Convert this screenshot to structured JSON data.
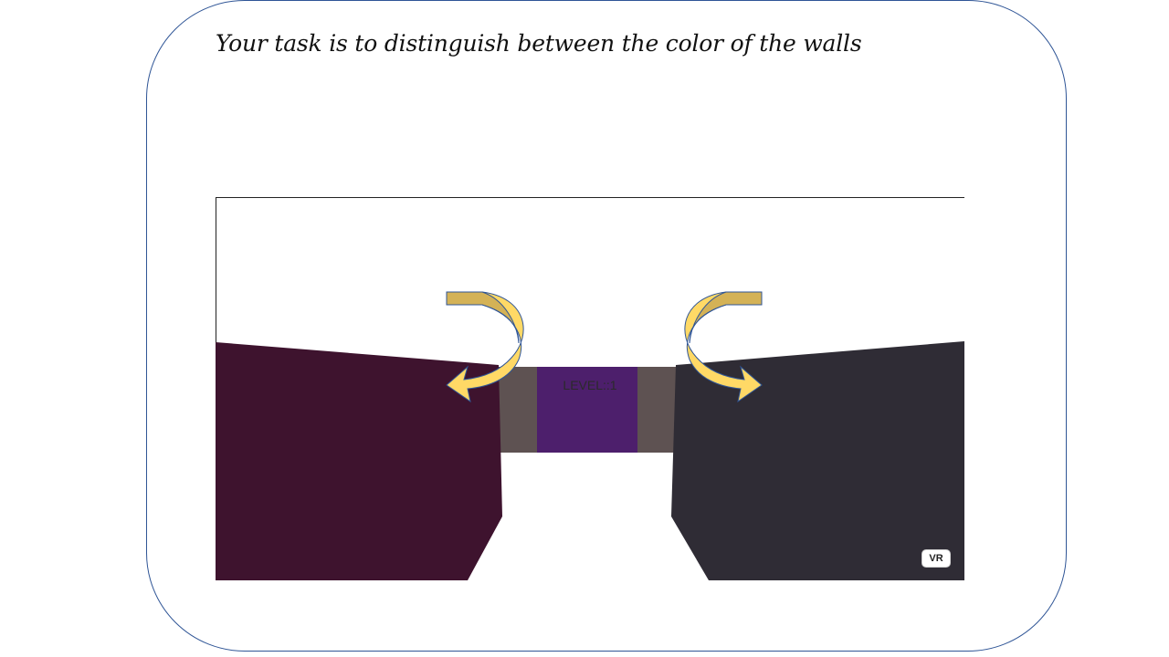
{
  "task": {
    "title": "Your task is to distinguish between the color of the walls"
  },
  "scene": {
    "level_label": "LEVEL::1",
    "vr_button_label": "VR",
    "colors": {
      "left_wall": "#3e132e",
      "right_wall": "#2f2c35",
      "far_wall_side": "#5e5252",
      "far_wall_center": "#4d1f6c",
      "arrow_top": "#d4b256",
      "arrow_bottom": "#ffd966",
      "arrow_outline": "#2f5596",
      "frame_border": "#2f5596"
    },
    "icons": [
      "turn-left-arrow-icon",
      "turn-right-arrow-icon"
    ]
  }
}
